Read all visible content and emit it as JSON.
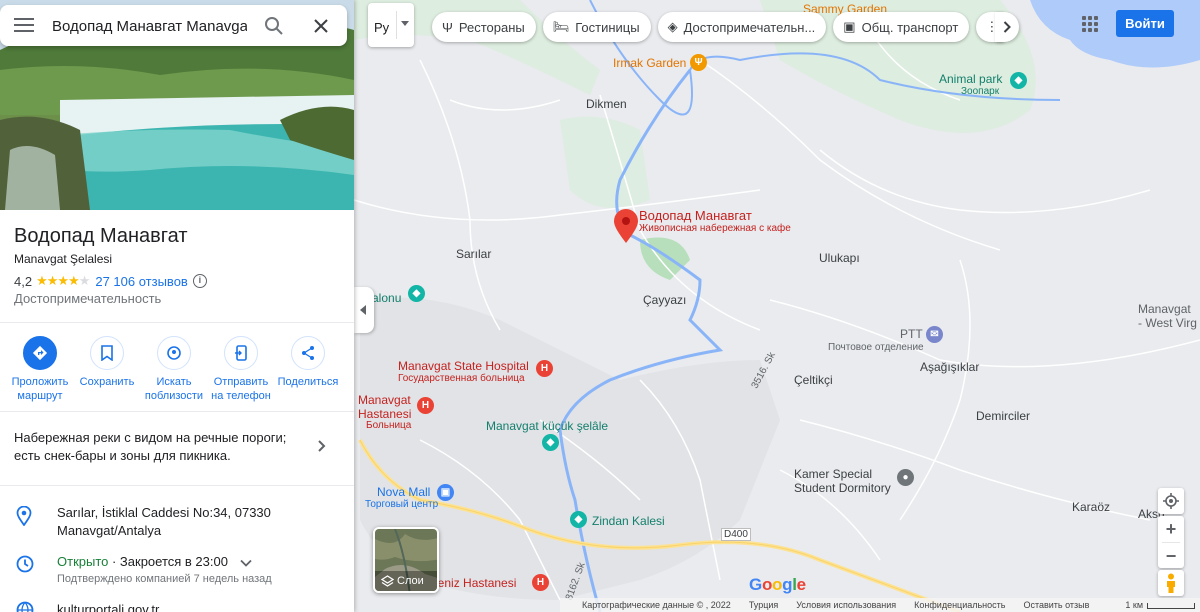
{
  "search": {
    "value": "Водопад Манавгат Manavgat Şelalesi"
  },
  "place": {
    "title": "Водопад Манавгат",
    "subtitle": "Manavgat Şelalesi",
    "rating": "4,2",
    "rating_value": 4.2,
    "reviews": "27 106 отзывов",
    "category": "Достопримечательность",
    "description": "Набережная реки с видом на речные пороги; есть снек-бары и зоны для пикника.",
    "address": "Sarılar, İstiklal Caddesi No:34, 07330 Manavgat/Antalya",
    "status_open": "Открыто",
    "status_close": " · Закроется в 23:00",
    "verified": "Подтверждено компанией 7 недель назад",
    "website": "kulturportali.gov.tr"
  },
  "actions": [
    {
      "label": "Проложить маршрут",
      "icon": "directions-icon"
    },
    {
      "label": "Сохранить",
      "icon": "bookmark-icon"
    },
    {
      "label": "Искать поблизости",
      "icon": "nearby-icon"
    },
    {
      "label": "Отправить на телефон",
      "icon": "send-to-phone-icon"
    },
    {
      "label": "Поделиться",
      "icon": "share-icon"
    }
  ],
  "topbar": {
    "layer_label": "Ру",
    "chips": [
      {
        "label": "Рестораны",
        "icon": "restaurant-icon"
      },
      {
        "label": "Гостиницы",
        "icon": "hotel-icon"
      },
      {
        "label": "Достопримечательн...",
        "icon": "attraction-icon"
      },
      {
        "label": "Общ. транспорт",
        "icon": "transit-icon"
      }
    ],
    "signin": "Войти"
  },
  "map": {
    "labels": {
      "sammy": "Sammy Garden",
      "irmak": "Irmak Garden",
      "animal_park": "Animal park",
      "zoo": "Зоопарк",
      "dikmen": "Dikmen",
      "selected_title": "Водопад Манавгат",
      "selected_sub": "Живописная набережная с кафе",
      "sarilar": "Sarılar",
      "ulukapi": "Ulukapı",
      "cayyazi": "Çayyazı",
      "alonu": "alonu",
      "ptt": "PTT",
      "ptt_sub": "Почтовое отделение",
      "asagisiklar": "Aşağışıklar",
      "manavgat_west": "Manavgat\n- West Virg",
      "state_hospital": "Manavgat State Hospital",
      "state_hospital_sub": "Государственная больница",
      "hastanesi": "Manavgat\nHastanesi",
      "hastanesi_sub": "Больница",
      "celtikci": "Çeltikçi",
      "street_3516": "3516. Sk",
      "kucuk_selale": "Manavgat küçük şelâle",
      "demirciler": "Demirciler",
      "kamer": "Kamer Special\nStudent Dormitory",
      "nova_mall": "Nova Mall",
      "nova_mall_sub": "Торговый центр",
      "zindan": "Zindan Kalesi",
      "karaoz": "Karaöz",
      "aksu": "Aksu",
      "road_d400": "D400",
      "street_8162": "8162. Sk",
      "deniz_hastanesi": "deniz Hastanesi"
    },
    "layers_label": "Слои",
    "google": "Google",
    "footer": {
      "data": "Картографические данные © , 2022",
      "country": "Турция",
      "terms": "Условия использования",
      "privacy": "Конфиденциальность",
      "feedback": "Оставить отзыв",
      "scale": "1 км"
    }
  },
  "colors": {
    "accent": "#1a73e8",
    "open": "#188038",
    "river": "#8ab4f8",
    "highway": "#fde293",
    "pin_red": "#ea4335"
  }
}
